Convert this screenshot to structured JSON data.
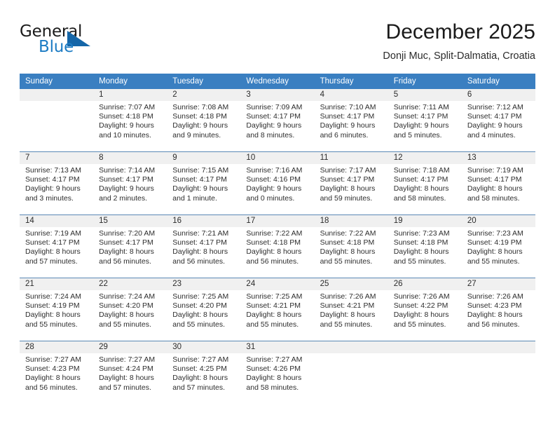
{
  "brand": {
    "word_one": "General",
    "word_two": "Blue",
    "triangle_icon": "blue-triangle-logo"
  },
  "header": {
    "title": "December 2025",
    "subtitle": "Donji Muc, Split-Dalmatia, Croatia"
  },
  "colors": {
    "header_row_bg": "#3a7fc1",
    "day_band_bg": "#f0f0f0",
    "row_divider": "#5a88b5",
    "brand_blue": "#1d7cc4",
    "text": "#2d2d2d"
  },
  "weekday_headers": [
    "Sunday",
    "Monday",
    "Tuesday",
    "Wednesday",
    "Thursday",
    "Friday",
    "Saturday"
  ],
  "weeks": [
    [
      {
        "day": "",
        "sunrise": "",
        "sunset": "",
        "daylight_line1": "",
        "daylight_line2": ""
      },
      {
        "day": "1",
        "sunrise": "Sunrise: 7:07 AM",
        "sunset": "Sunset: 4:18 PM",
        "daylight_line1": "Daylight: 9 hours",
        "daylight_line2": "and 10 minutes."
      },
      {
        "day": "2",
        "sunrise": "Sunrise: 7:08 AM",
        "sunset": "Sunset: 4:18 PM",
        "daylight_line1": "Daylight: 9 hours",
        "daylight_line2": "and 9 minutes."
      },
      {
        "day": "3",
        "sunrise": "Sunrise: 7:09 AM",
        "sunset": "Sunset: 4:17 PM",
        "daylight_line1": "Daylight: 9 hours",
        "daylight_line2": "and 8 minutes."
      },
      {
        "day": "4",
        "sunrise": "Sunrise: 7:10 AM",
        "sunset": "Sunset: 4:17 PM",
        "daylight_line1": "Daylight: 9 hours",
        "daylight_line2": "and 6 minutes."
      },
      {
        "day": "5",
        "sunrise": "Sunrise: 7:11 AM",
        "sunset": "Sunset: 4:17 PM",
        "daylight_line1": "Daylight: 9 hours",
        "daylight_line2": "and 5 minutes."
      },
      {
        "day": "6",
        "sunrise": "Sunrise: 7:12 AM",
        "sunset": "Sunset: 4:17 PM",
        "daylight_line1": "Daylight: 9 hours",
        "daylight_line2": "and 4 minutes."
      }
    ],
    [
      {
        "day": "7",
        "sunrise": "Sunrise: 7:13 AM",
        "sunset": "Sunset: 4:17 PM",
        "daylight_line1": "Daylight: 9 hours",
        "daylight_line2": "and 3 minutes."
      },
      {
        "day": "8",
        "sunrise": "Sunrise: 7:14 AM",
        "sunset": "Sunset: 4:17 PM",
        "daylight_line1": "Daylight: 9 hours",
        "daylight_line2": "and 2 minutes."
      },
      {
        "day": "9",
        "sunrise": "Sunrise: 7:15 AM",
        "sunset": "Sunset: 4:17 PM",
        "daylight_line1": "Daylight: 9 hours",
        "daylight_line2": "and 1 minute."
      },
      {
        "day": "10",
        "sunrise": "Sunrise: 7:16 AM",
        "sunset": "Sunset: 4:16 PM",
        "daylight_line1": "Daylight: 9 hours",
        "daylight_line2": "and 0 minutes."
      },
      {
        "day": "11",
        "sunrise": "Sunrise: 7:17 AM",
        "sunset": "Sunset: 4:17 PM",
        "daylight_line1": "Daylight: 8 hours",
        "daylight_line2": "and 59 minutes."
      },
      {
        "day": "12",
        "sunrise": "Sunrise: 7:18 AM",
        "sunset": "Sunset: 4:17 PM",
        "daylight_line1": "Daylight: 8 hours",
        "daylight_line2": "and 58 minutes."
      },
      {
        "day": "13",
        "sunrise": "Sunrise: 7:19 AM",
        "sunset": "Sunset: 4:17 PM",
        "daylight_line1": "Daylight: 8 hours",
        "daylight_line2": "and 58 minutes."
      }
    ],
    [
      {
        "day": "14",
        "sunrise": "Sunrise: 7:19 AM",
        "sunset": "Sunset: 4:17 PM",
        "daylight_line1": "Daylight: 8 hours",
        "daylight_line2": "and 57 minutes."
      },
      {
        "day": "15",
        "sunrise": "Sunrise: 7:20 AM",
        "sunset": "Sunset: 4:17 PM",
        "daylight_line1": "Daylight: 8 hours",
        "daylight_line2": "and 56 minutes."
      },
      {
        "day": "16",
        "sunrise": "Sunrise: 7:21 AM",
        "sunset": "Sunset: 4:17 PM",
        "daylight_line1": "Daylight: 8 hours",
        "daylight_line2": "and 56 minutes."
      },
      {
        "day": "17",
        "sunrise": "Sunrise: 7:22 AM",
        "sunset": "Sunset: 4:18 PM",
        "daylight_line1": "Daylight: 8 hours",
        "daylight_line2": "and 56 minutes."
      },
      {
        "day": "18",
        "sunrise": "Sunrise: 7:22 AM",
        "sunset": "Sunset: 4:18 PM",
        "daylight_line1": "Daylight: 8 hours",
        "daylight_line2": "and 55 minutes."
      },
      {
        "day": "19",
        "sunrise": "Sunrise: 7:23 AM",
        "sunset": "Sunset: 4:18 PM",
        "daylight_line1": "Daylight: 8 hours",
        "daylight_line2": "and 55 minutes."
      },
      {
        "day": "20",
        "sunrise": "Sunrise: 7:23 AM",
        "sunset": "Sunset: 4:19 PM",
        "daylight_line1": "Daylight: 8 hours",
        "daylight_line2": "and 55 minutes."
      }
    ],
    [
      {
        "day": "21",
        "sunrise": "Sunrise: 7:24 AM",
        "sunset": "Sunset: 4:19 PM",
        "daylight_line1": "Daylight: 8 hours",
        "daylight_line2": "and 55 minutes."
      },
      {
        "day": "22",
        "sunrise": "Sunrise: 7:24 AM",
        "sunset": "Sunset: 4:20 PM",
        "daylight_line1": "Daylight: 8 hours",
        "daylight_line2": "and 55 minutes."
      },
      {
        "day": "23",
        "sunrise": "Sunrise: 7:25 AM",
        "sunset": "Sunset: 4:20 PM",
        "daylight_line1": "Daylight: 8 hours",
        "daylight_line2": "and 55 minutes."
      },
      {
        "day": "24",
        "sunrise": "Sunrise: 7:25 AM",
        "sunset": "Sunset: 4:21 PM",
        "daylight_line1": "Daylight: 8 hours",
        "daylight_line2": "and 55 minutes."
      },
      {
        "day": "25",
        "sunrise": "Sunrise: 7:26 AM",
        "sunset": "Sunset: 4:21 PM",
        "daylight_line1": "Daylight: 8 hours",
        "daylight_line2": "and 55 minutes."
      },
      {
        "day": "26",
        "sunrise": "Sunrise: 7:26 AM",
        "sunset": "Sunset: 4:22 PM",
        "daylight_line1": "Daylight: 8 hours",
        "daylight_line2": "and 55 minutes."
      },
      {
        "day": "27",
        "sunrise": "Sunrise: 7:26 AM",
        "sunset": "Sunset: 4:23 PM",
        "daylight_line1": "Daylight: 8 hours",
        "daylight_line2": "and 56 minutes."
      }
    ],
    [
      {
        "day": "28",
        "sunrise": "Sunrise: 7:27 AM",
        "sunset": "Sunset: 4:23 PM",
        "daylight_line1": "Daylight: 8 hours",
        "daylight_line2": "and 56 minutes."
      },
      {
        "day": "29",
        "sunrise": "Sunrise: 7:27 AM",
        "sunset": "Sunset: 4:24 PM",
        "daylight_line1": "Daylight: 8 hours",
        "daylight_line2": "and 57 minutes."
      },
      {
        "day": "30",
        "sunrise": "Sunrise: 7:27 AM",
        "sunset": "Sunset: 4:25 PM",
        "daylight_line1": "Daylight: 8 hours",
        "daylight_line2": "and 57 minutes."
      },
      {
        "day": "31",
        "sunrise": "Sunrise: 7:27 AM",
        "sunset": "Sunset: 4:26 PM",
        "daylight_line1": "Daylight: 8 hours",
        "daylight_line2": "and 58 minutes."
      },
      {
        "day": "",
        "sunrise": "",
        "sunset": "",
        "daylight_line1": "",
        "daylight_line2": ""
      },
      {
        "day": "",
        "sunrise": "",
        "sunset": "",
        "daylight_line1": "",
        "daylight_line2": ""
      },
      {
        "day": "",
        "sunrise": "",
        "sunset": "",
        "daylight_line1": "",
        "daylight_line2": ""
      }
    ]
  ]
}
